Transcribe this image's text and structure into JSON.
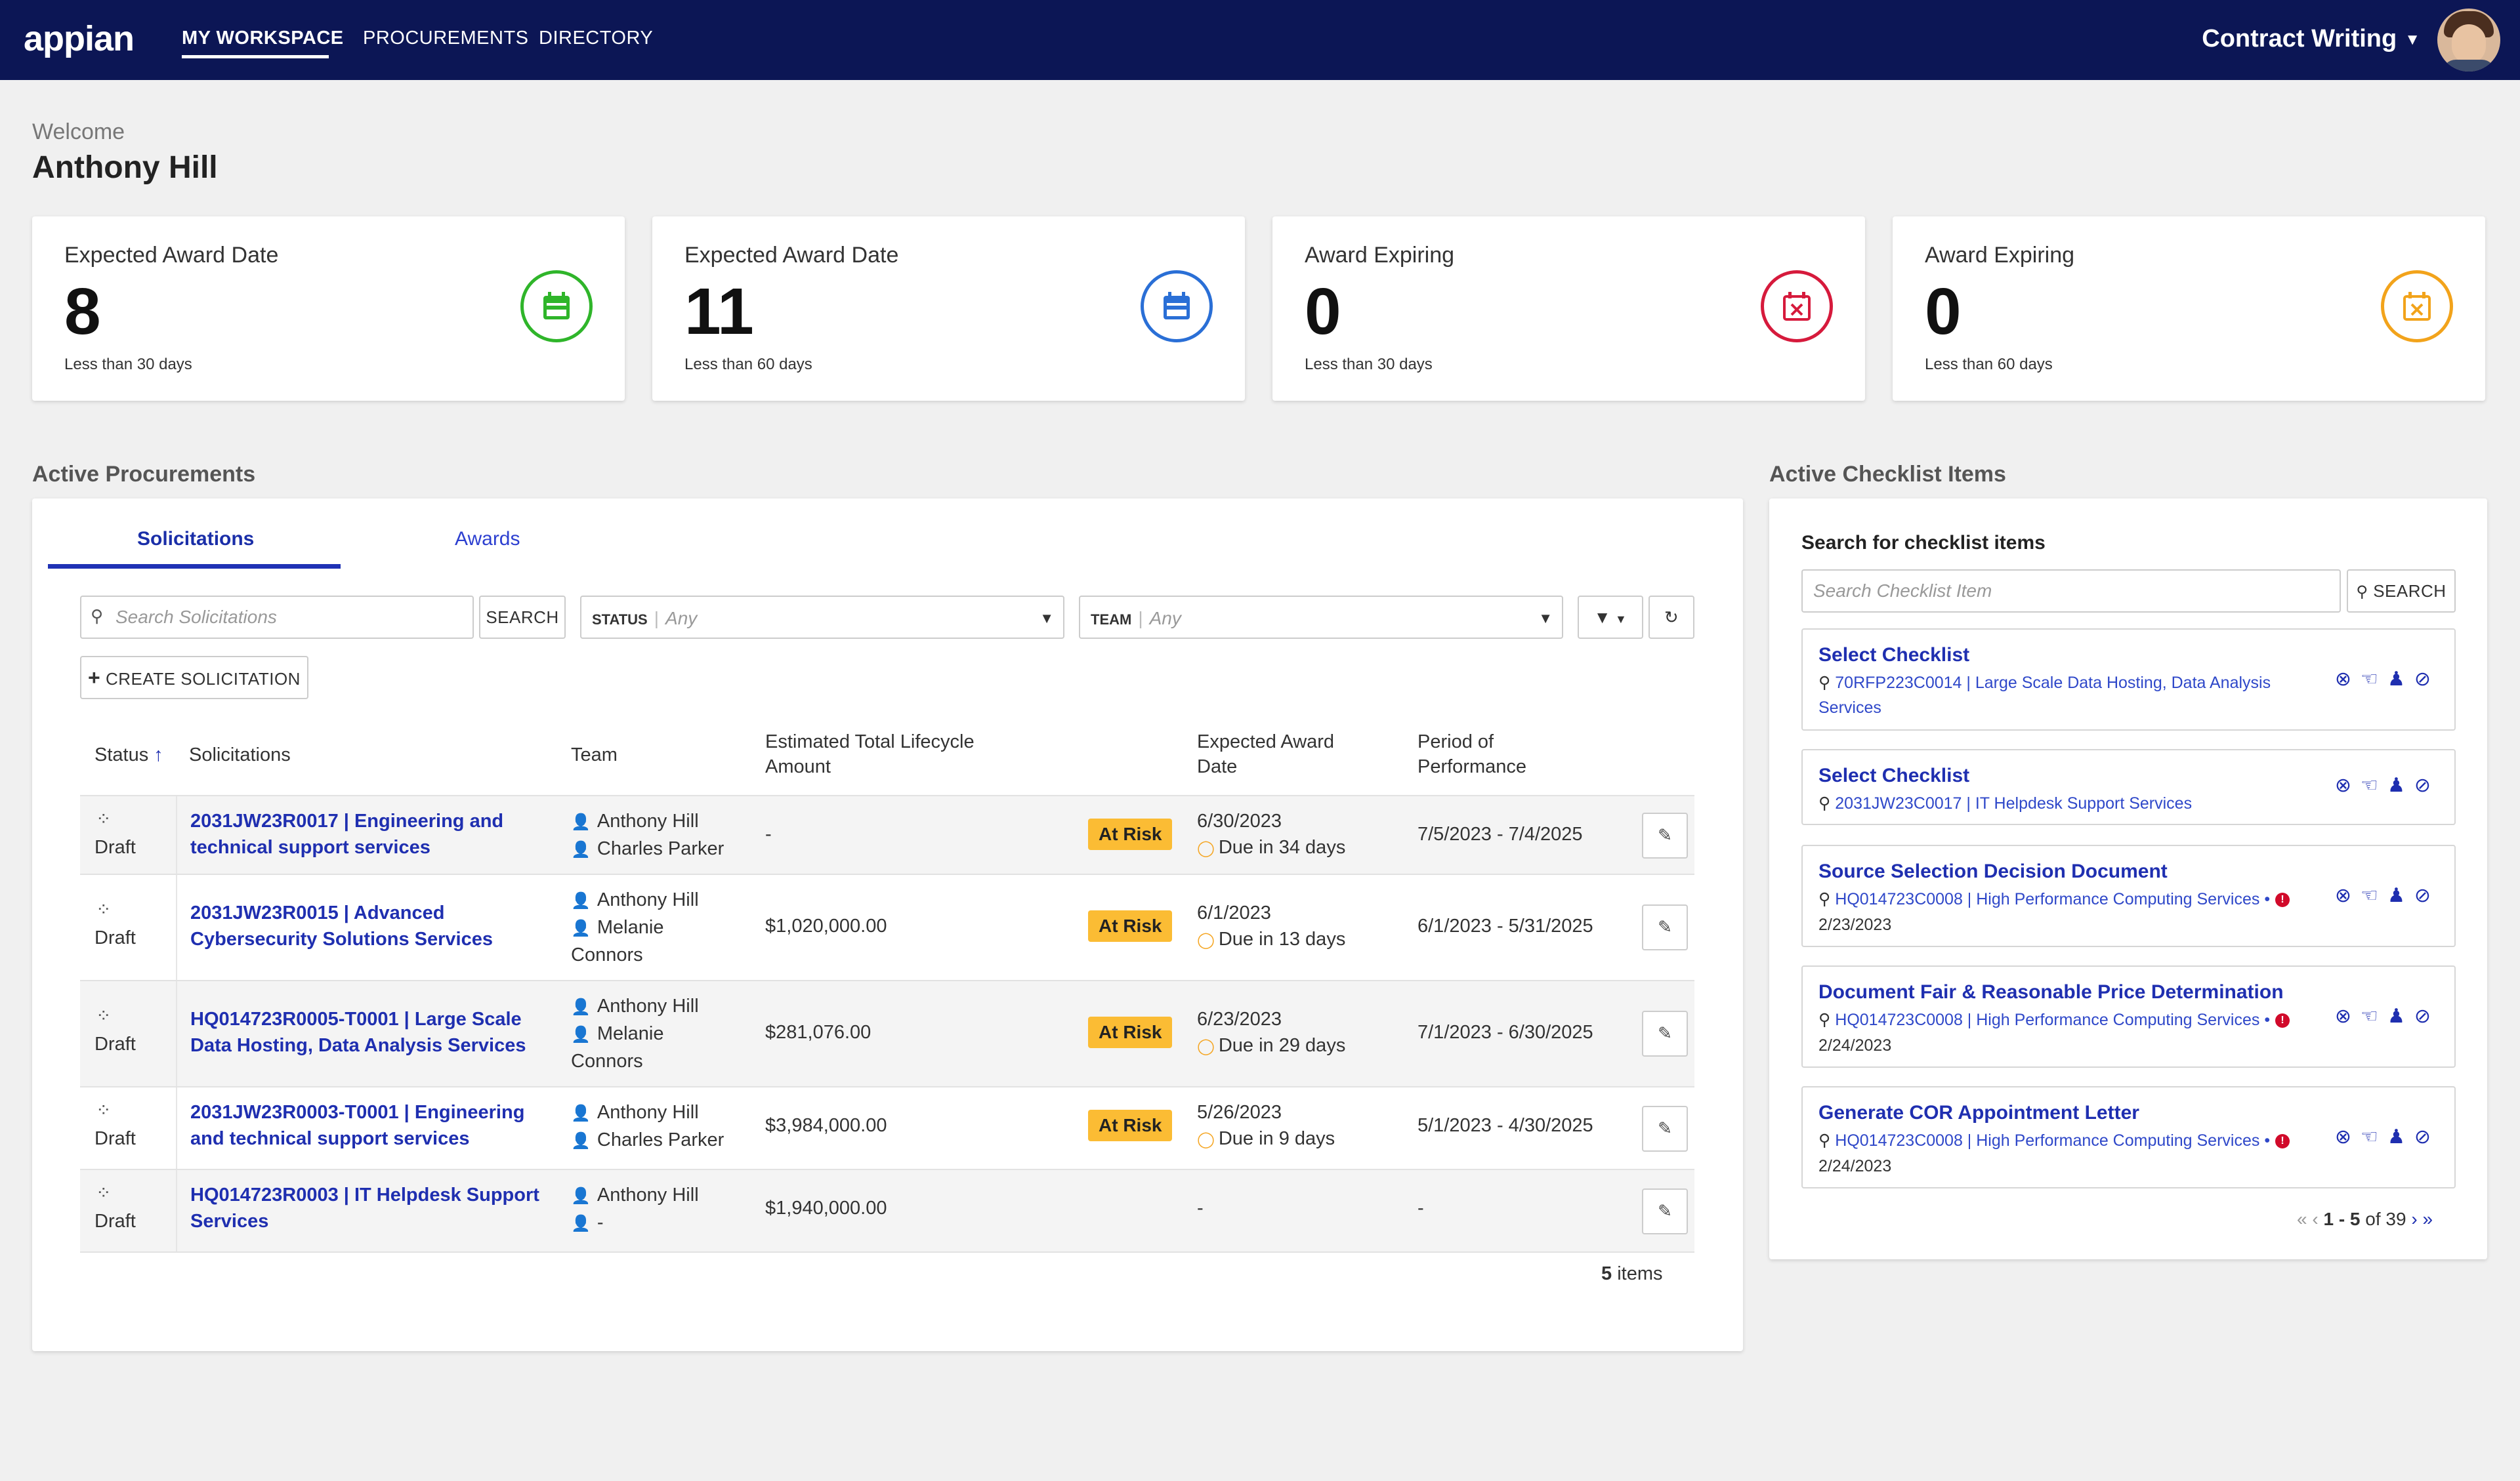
{
  "nav": {
    "logo": "appian",
    "items": [
      "MY WORKSPACE",
      "PROCUREMENTS",
      "DIRECTORY"
    ],
    "app_switcher": "Contract Writing"
  },
  "welcome": {
    "greeting": "Welcome",
    "name": "Anthony Hill"
  },
  "kpis": [
    {
      "title": "Expected Award Date",
      "value": "8",
      "sub": "Less than 30 days",
      "color": "#2fb52a",
      "icon": "calendar-icon"
    },
    {
      "title": "Expected Award Date",
      "value": "11",
      "sub": "Less than 60 days",
      "color": "#2a6fd6",
      "icon": "calendar-icon"
    },
    {
      "title": "Award Expiring",
      "value": "0",
      "sub": "Less than 30 days",
      "color": "#d61a3c",
      "icon": "calendar-x-icon"
    },
    {
      "title": "Award Expiring",
      "value": "0",
      "sub": "Less than 60 days",
      "color": "#f2a31b",
      "icon": "calendar-x-icon"
    }
  ],
  "procurements": {
    "title": "Active Procurements",
    "tabs": [
      "Solicitations",
      "Awards"
    ],
    "search_placeholder": "Search Solicitations",
    "search_button": "SEARCH",
    "status_label": "STATUS",
    "status_value": "Any",
    "team_label": "TEAM",
    "team_value": "Any",
    "create_button": "CREATE SOLICITATION",
    "columns": {
      "status": "Status",
      "solicitations": "Solicitations",
      "team": "Team",
      "amount_1": "Estimated Total Lifecycle",
      "amount_2": "Amount",
      "award_1": "Expected Award",
      "award_2": "Date",
      "period_1": "Period of",
      "period_2": "Performance"
    },
    "rows": [
      {
        "status": "Draft",
        "title_1": "2031JW23R0017 | Engineering and",
        "title_2": "technical support services",
        "team_1": "Anthony Hill",
        "team_2": "Charles Parker",
        "team_3": "",
        "amount": "-",
        "risk": "At Risk",
        "award_date": "6/30/2023",
        "due": "Due in 34 days",
        "period": "7/5/2023 - 7/4/2025"
      },
      {
        "status": "Draft",
        "title_1": "2031JW23R0015 | Advanced",
        "title_2": "Cybersecurity Solutions Services",
        "team_1": "Anthony Hill",
        "team_2": "Melanie",
        "team_3": "Connors",
        "amount": "$1,020,000.00",
        "risk": "At Risk",
        "award_date": "6/1/2023",
        "due": "Due in 13 days",
        "period": "6/1/2023 - 5/31/2025"
      },
      {
        "status": "Draft",
        "title_1": "HQ014723R0005-T0001 | Large Scale",
        "title_2": "Data Hosting, Data Analysis Services",
        "team_1": "Anthony Hill",
        "team_2": "Melanie",
        "team_3": "Connors",
        "amount": "$281,076.00",
        "risk": "At Risk",
        "award_date": "6/23/2023",
        "due": "Due in 29 days",
        "period": "7/1/2023 - 6/30/2025"
      },
      {
        "status": "Draft",
        "title_1": "2031JW23R0003-T0001 | Engineering",
        "title_2": "and technical support services",
        "team_1": "Anthony Hill",
        "team_2": "Charles Parker",
        "team_3": "",
        "amount": "$3,984,000.00",
        "risk": "At Risk",
        "award_date": "5/26/2023",
        "due": "Due in 9 days",
        "period": "5/1/2023 - 4/30/2025"
      },
      {
        "status": "Draft",
        "title_1": "HQ014723R0003 | IT Helpdesk Support",
        "title_2": "Services",
        "team_1": "Anthony Hill",
        "team_2": "-",
        "team_3": "",
        "amount": "$1,940,000.00",
        "risk": "",
        "award_date": "-",
        "due": "",
        "period": "-"
      }
    ],
    "items_count": "5",
    "items_label": "items"
  },
  "checklist": {
    "title": "Active Checklist Items",
    "search_label": "Search for checklist items",
    "search_placeholder": "Search Checklist Item",
    "search_button": "SEARCH",
    "items": [
      {
        "title": "Select Checklist",
        "ref_1": "70RFP223C0014 | Large Scale Data Hosting, Data Analysis",
        "ref_2": "Services",
        "date": ""
      },
      {
        "title": "Select Checklist",
        "ref_1": "2031JW23C0017 | IT Helpdesk Support Services",
        "ref_2": "",
        "date": ""
      },
      {
        "title": "Source Selection Decision Document",
        "ref_1": "HQ014723C0008 | High Performance Computing Services •",
        "ref_2": "",
        "date": "2/23/2023"
      },
      {
        "title": "Document Fair & Reasonable Price Determination",
        "ref_1": "HQ014723C0008 | High Performance Computing Services •",
        "ref_2": "",
        "date": "2/24/2023"
      },
      {
        "title": "Generate COR Appointment Letter",
        "ref_1": "HQ014723C0008 | High Performance Computing Services •",
        "ref_2": "",
        "date": "2/24/2023"
      }
    ],
    "pager_range": "1 - 5",
    "pager_total": "of 39"
  }
}
